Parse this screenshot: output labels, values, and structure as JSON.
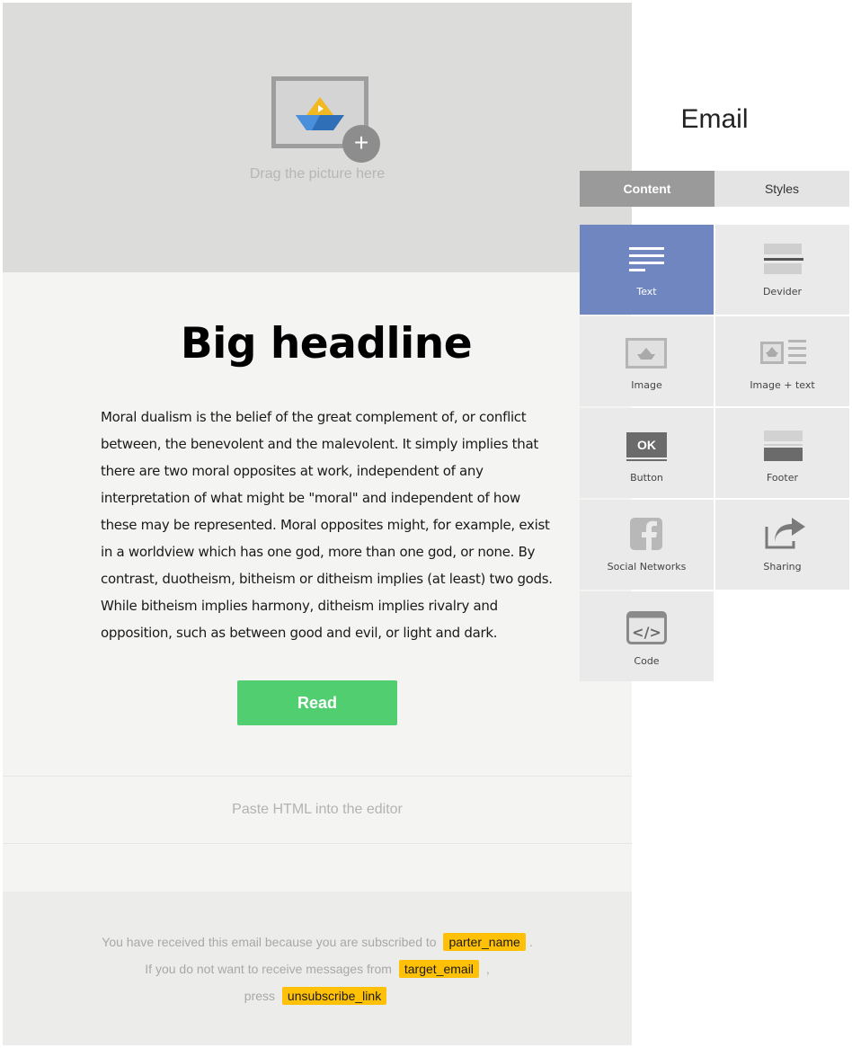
{
  "canvas": {
    "hero_caption": "Drag the picture here",
    "headline": "Big headline",
    "body": "Moral dualism is the belief of the great complement of, or conflict between, the benevolent and the malevolent. It simply implies that there are two moral opposites at work, independent of any interpretation of what might be \"moral\" and independent of how these may be represented. Moral opposites might, for example, exist in a worldview which has one god, more than one god, or none. By contrast, duotheism, bitheism or ditheism implies (at least) two gods. While bitheism implies harmony, ditheism implies rivalry and opposition, such as between good and evil, or light and dark.",
    "read_button": "Read",
    "html_placeholder": "Paste HTML into the editor",
    "footer": {
      "line1_text": "You have received this email because you are subscribed to",
      "line1_tag": "parter_name",
      "line1_end": ".",
      "line2_text": "If you do not want to receive messages from",
      "line2_tag": "target_email",
      "line2_end": ",",
      "line3_text": "press",
      "line3_tag": "unsubscribe_link"
    }
  },
  "panel": {
    "title": "Email",
    "tabs": [
      {
        "label": "Content",
        "active": true
      },
      {
        "label": "Styles",
        "active": false
      }
    ],
    "blocks": [
      {
        "label": "Text",
        "icon": "text-lines-icon",
        "selected": true
      },
      {
        "label": "Devider",
        "icon": "divider-icon"
      },
      {
        "label": "Image",
        "icon": "image-icon"
      },
      {
        "label": "Image + text",
        "icon": "image-text-icon"
      },
      {
        "label": "Button",
        "icon": "button-icon",
        "icon_text": "OK"
      },
      {
        "label": "Footer",
        "icon": "footer-icon"
      },
      {
        "label": "Social Networks",
        "icon": "facebook-icon"
      },
      {
        "label": "Sharing",
        "icon": "share-arrow-icon"
      },
      {
        "label": "Code",
        "icon": "code-icon"
      }
    ]
  },
  "colors": {
    "accent_selected": "#6f86c1",
    "button_green": "#51ce70",
    "tag_yellow": "#ffc107"
  }
}
